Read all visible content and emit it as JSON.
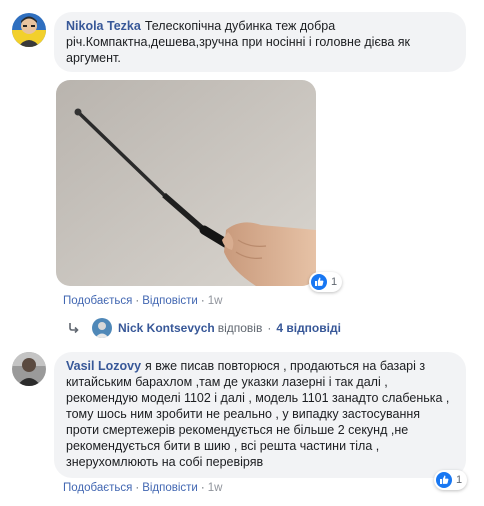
{
  "comment1": {
    "author": "Nikola Tezka",
    "text": "Телескопічна дубинка теж добра річ.Компактна,дешева,зручна при носінні і головне дієва як аргумент.",
    "reactions": "1",
    "like": "Подобається",
    "reply": "Відповісти",
    "time": "1w",
    "photo_icon": "photo-telescopic-baton"
  },
  "replies_summary": {
    "name": "Nick Kontsevych",
    "verb": "відповів",
    "count": "4 відповіді",
    "icon": "reply-arrow-icon"
  },
  "comment2": {
    "author": "Vasil Lozovy",
    "text": "я вже писав повторюся , продаються на базарі з китайським барахлом ,там де указки лазерні і так далі , рекомендую моделі 1102 і далі , модель 1101 занадто слабенька , тому шось ним зробити не реально , у випадку застосування проти смертежерів рекомендується не більше 2 секунд ,не рекомендується бити в шию , всі решта частини тіла , знерухомлюють на собі перевіряв",
    "reactions": "1",
    "like": "Подобається",
    "reply": "Відповісти",
    "time": "1w"
  },
  "colors": {
    "link": "#4267b2",
    "author": "#385898",
    "bubble": "#f2f3f5",
    "like_blue": "#1877f2"
  }
}
